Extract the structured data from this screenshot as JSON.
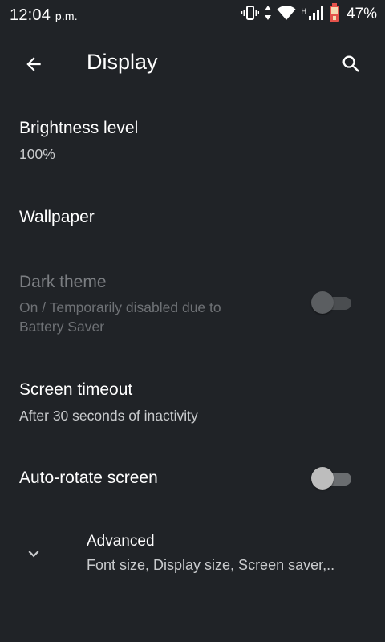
{
  "status_bar": {
    "time": "12:04",
    "ampm": "p.m.",
    "network_type": "H",
    "battery_percent": "47%",
    "icons": [
      "vibrate-icon",
      "data-arrows-icon",
      "wifi-icon",
      "signal-icon",
      "battery-icon"
    ]
  },
  "app_bar": {
    "title": "Display",
    "back_icon": "arrow-back-icon",
    "search_icon": "search-icon"
  },
  "settings": {
    "brightness": {
      "title": "Brightness level",
      "summary": "100%"
    },
    "wallpaper": {
      "title": "Wallpaper"
    },
    "dark_theme": {
      "title": "Dark theme",
      "summary_line1": "On / Temporarily disabled due to",
      "summary_line2": "Battery Saver",
      "toggle_on": false,
      "enabled": false
    },
    "screen_timeout": {
      "title": "Screen timeout",
      "summary": "After 30 seconds of inactivity"
    },
    "auto_rotate": {
      "title": "Auto-rotate screen",
      "toggle_on": false
    },
    "advanced": {
      "title": "Advanced",
      "summary": "Font size, Display size, Screen saver,..",
      "icon": "chevron-down-icon"
    }
  },
  "colors": {
    "background": "#202327",
    "text_primary": "#ffffff",
    "text_secondary": "#c9cbcd",
    "text_disabled": "#7b7e82",
    "battery_accent": "#e5534b"
  }
}
